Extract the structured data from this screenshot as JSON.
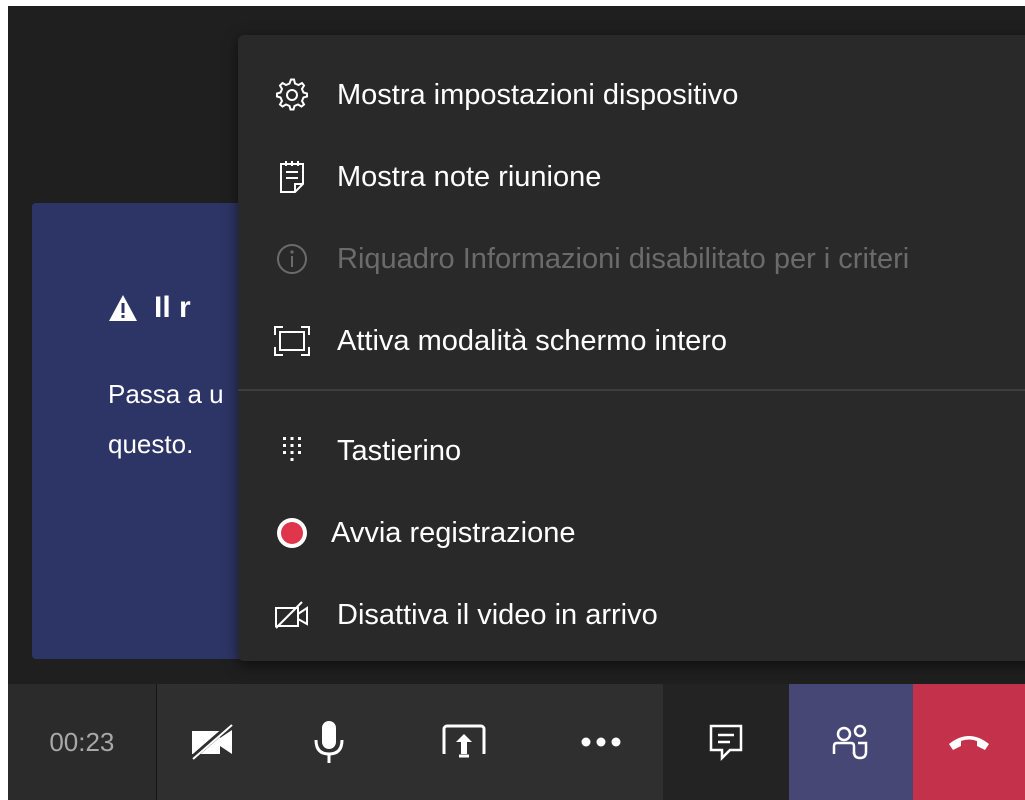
{
  "notice": {
    "title": "Il r",
    "body_line1": "Passa a u",
    "body_line2": "questo.",
    "icon": "warning-icon"
  },
  "menu": {
    "items": [
      {
        "label": "Mostra impostazioni dispositivo",
        "icon": "gear-icon",
        "enabled": true
      },
      {
        "label": "Mostra note riunione",
        "icon": "notes-icon",
        "enabled": true
      },
      {
        "label": "Riquadro Informazioni disabilitato per i criteri",
        "icon": "info-icon",
        "enabled": false
      },
      {
        "label": "Attiva modalità schermo intero",
        "icon": "fullscreen-icon",
        "enabled": true
      },
      {
        "label": "Tastierino",
        "icon": "dialpad-icon",
        "enabled": true
      },
      {
        "label": "Avvia registrazione",
        "icon": "record-icon",
        "enabled": true
      },
      {
        "label": "Disattiva il video in arrivo",
        "icon": "video-off-icon",
        "enabled": true
      }
    ]
  },
  "toolbar": {
    "timer": "00:23",
    "buttons": [
      "camera-off-icon",
      "microphone-icon",
      "share-screen-icon",
      "more-icon",
      "chat-icon",
      "participants-icon",
      "hang-up-icon"
    ]
  },
  "colors": {
    "record": "#e0364b",
    "hangup": "#c4314b",
    "people_active": "#464775",
    "notice_bg": "#2d3566"
  }
}
